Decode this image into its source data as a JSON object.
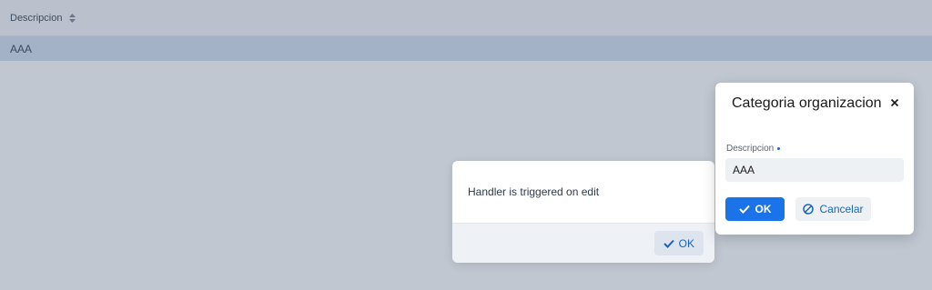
{
  "grid": {
    "columns": [
      {
        "label": "Descripcion",
        "icon": "sort-icon"
      }
    ],
    "rows": [
      {
        "descripcion": "AAA",
        "selected": true
      }
    ]
  },
  "notification": {
    "message": "Handler is triggered on edit",
    "ok_label": "OK",
    "ok_icon": "checkmark-icon"
  },
  "dialog": {
    "title": "Categoria organizacion",
    "close_icon": "close-icon",
    "field": {
      "label": "Descripcion",
      "required": true,
      "value": "AAA"
    },
    "ok_label": "OK",
    "ok_icon": "checkmark-icon",
    "cancel_label": "Cancelar",
    "cancel_icon": "ban-icon"
  },
  "colors": {
    "primary": "#1a73e8",
    "link": "#1565c0",
    "selected_row": "#cfdcef"
  }
}
